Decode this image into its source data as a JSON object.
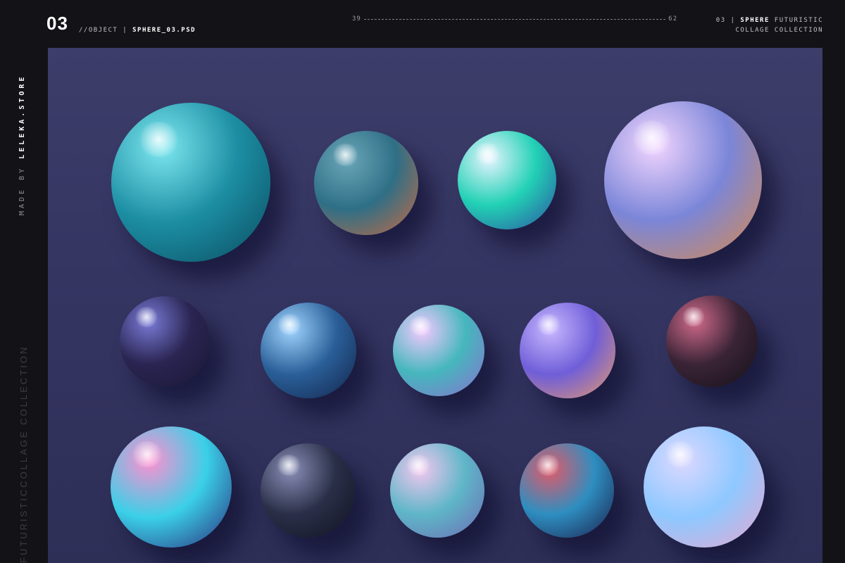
{
  "header": {
    "number": "03",
    "object_prefix": "//OBJECT | ",
    "object_file": "SPHERE_03.PSD",
    "page_start": "39",
    "page_end": "62",
    "title_prefix": "03 | ",
    "title_bold": "SPHERE",
    "title_rest": " FUTURISTIC",
    "title_line2": "COLLAGE COLLECTION"
  },
  "side": {
    "credit_prefix": "MADE BY ",
    "credit_store": "LELEKA.STORE",
    "collection_text": "FUTURISTICCOLLAGE COLLECTION"
  },
  "colors": {
    "frame": "#131317",
    "canvas": "#353562",
    "accent_white": "#ffffff"
  },
  "spheres": [
    {
      "name": "teal-liquid-glass-sphere",
      "colors": [
        "#7ee8f0",
        "#1c8ea3",
        "#0b4a5e"
      ]
    },
    {
      "name": "clear-bubble-sphere-orange-rim",
      "colors": [
        "#6aa6b8",
        "#2f6f86",
        "#c96a42"
      ]
    },
    {
      "name": "glass-sphere-green-reflection",
      "colors": [
        "#e6f4ff",
        "#22d1b5",
        "#2c4fa0"
      ]
    },
    {
      "name": "large-iridescent-glass-sphere",
      "colors": [
        "#f2d5ff",
        "#7b86d8",
        "#d98a4a"
      ]
    },
    {
      "name": "dotted-purple-sphere",
      "colors": [
        "#7a7bd8",
        "#2a2552",
        "#1a1633"
      ]
    },
    {
      "name": "blue-glass-marble-sphere",
      "colors": [
        "#9fd4ff",
        "#2a5f98",
        "#12244a"
      ]
    },
    {
      "name": "pastel-teal-bubble-sphere",
      "colors": [
        "#f3c9ff",
        "#45b7bd",
        "#8a6fd0"
      ]
    },
    {
      "name": "holographic-swirl-sphere",
      "colors": [
        "#c8b8ff",
        "#6f5ed8",
        "#e89a6a"
      ]
    },
    {
      "name": "scaled-pink-texture-sphere",
      "colors": [
        "#d06a8a",
        "#3a2436",
        "#141018"
      ]
    },
    {
      "name": "marbled-neon-swirl-sphere",
      "colors": [
        "#ff8fd0",
        "#3ad0e8",
        "#2a2a7a"
      ]
    },
    {
      "name": "dark-glitter-sphere",
      "colors": [
        "#8a8fb8",
        "#2a2f48",
        "#101220"
      ]
    },
    {
      "name": "frosted-iridescent-sphere",
      "colors": [
        "#f2c7ef",
        "#5fb6c8",
        "#6c6ab4"
      ]
    },
    {
      "name": "striped-rainbow-sphere",
      "colors": [
        "#e05a6a",
        "#2e8ec0",
        "#1a1e4a"
      ]
    },
    {
      "name": "large-holographic-clear-sphere",
      "colors": [
        "#dcd8ff",
        "#8ec8ff",
        "#e8a8d0"
      ]
    }
  ]
}
